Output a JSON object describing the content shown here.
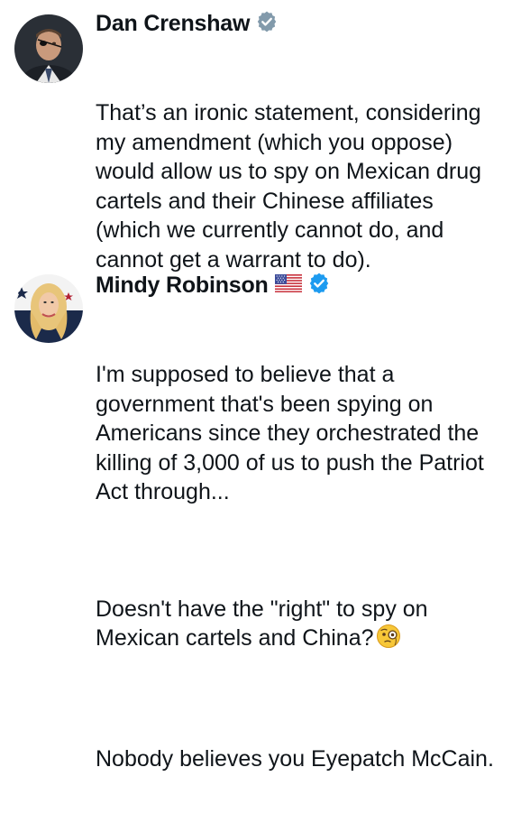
{
  "tweets": [
    {
      "author_name": "Dan Crenshaw",
      "avatar_icon": "profile-photo-dan-crenshaw",
      "verified_icon": "verified-badge-icon-gray",
      "paragraphs": [
        "That’s an ironic statement, considering my amendment (which you oppose) would allow us to spy on Mexican drug cartels and their Chinese affiliates (which we currently cannot do, and cannot get a warrant to do)."
      ]
    },
    {
      "author_name": "Mindy Robinson",
      "avatar_icon": "profile-photo-mindy-robinson",
      "flag_icon": "us-flag-emoji",
      "verified_icon": "verified-badge-icon-blue",
      "paragraphs": [
        "I'm supposed to believe that a government that's been spying on Americans since they orchestrated the killing of 3,000 of us to push the Patriot Act through...",
        "Doesn't have the \"right\" to spy on Mexican cartels and China?",
        "Nobody believes you Eyepatch McCain."
      ],
      "emoji_icon": "face-with-monocle-emoji"
    }
  ]
}
